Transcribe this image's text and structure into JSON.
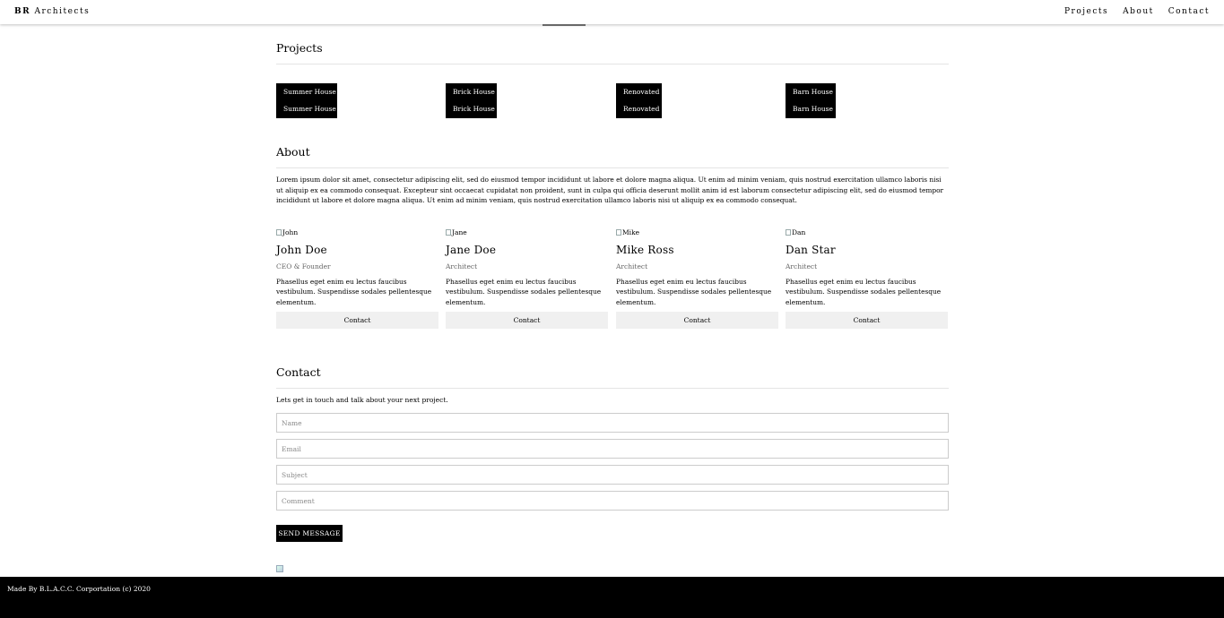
{
  "header": {
    "brand_bold": "BR",
    "brand_rest": " Architects",
    "nav": [
      "Projects",
      "About",
      "Contact"
    ]
  },
  "projects": {
    "title": "Projects",
    "items": [
      {
        "line1": "Summer House",
        "line2": "Summer House"
      },
      {
        "line1": "Brick House",
        "line2": "Brick House"
      },
      {
        "line1": "Renovated",
        "line2": "Renovated"
      },
      {
        "line1": "Barn House",
        "line2": "Barn House"
      }
    ]
  },
  "about": {
    "title": "About",
    "text": "Lorem ipsum dolor sit amet, consectetur adipiscing elit, sed do eiusmod tempor incididunt ut labore et dolore magna aliqua. Ut enim ad minim veniam, quis nostrud exercitation ullamco laboris nisi ut aliquip ex ea commodo consequat. Excepteur sint occaecat cupidatat non proident, sunt in culpa qui officia deserunt mollit anim id est laborum consectetur adipiscing elit, sed do eiusmod tempor incididunt ut labore et dolore magna aliqua. Ut enim ad minim veniam, quis nostrud exercitation ullamco laboris nisi ut aliquip ex ea commodo consequat.",
    "team": [
      {
        "img_alt": "John",
        "name": "John Doe",
        "role": "CEO & Founder",
        "desc": "Phasellus eget enim eu lectus faucibus vestibulum. Suspendisse sodales pellentesque elementum.",
        "button": "Contact"
      },
      {
        "img_alt": "Jane",
        "name": "Jane Doe",
        "role": "Architect",
        "desc": "Phasellus eget enim eu lectus faucibus vestibulum. Suspendisse sodales pellentesque elementum.",
        "button": "Contact"
      },
      {
        "img_alt": "Mike",
        "name": "Mike Ross",
        "role": "Architect",
        "desc": "Phasellus eget enim eu lectus faucibus vestibulum. Suspendisse sodales pellentesque elementum.",
        "button": "Contact"
      },
      {
        "img_alt": "Dan",
        "name": "Dan Star",
        "role": "Architect",
        "desc": "Phasellus eget enim eu lectus faucibus vestibulum. Suspendisse sodales pellentesque elementum.",
        "button": "Contact"
      }
    ]
  },
  "contact": {
    "title": "Contact",
    "intro": "Lets get in touch and talk about your next project.",
    "fields": {
      "name_placeholder": "Name",
      "email_placeholder": "Email",
      "subject_placeholder": "Subject",
      "comment_placeholder": "Comment"
    },
    "send_label": "SEND MESSAGE"
  },
  "footer": {
    "text": "Made By B.L.A.C.C. Corportation (c) 2020"
  },
  "colors": {
    "accent": "#000000",
    "button_bg": "#f0f0f0",
    "rule": "#e4e4e4"
  }
}
